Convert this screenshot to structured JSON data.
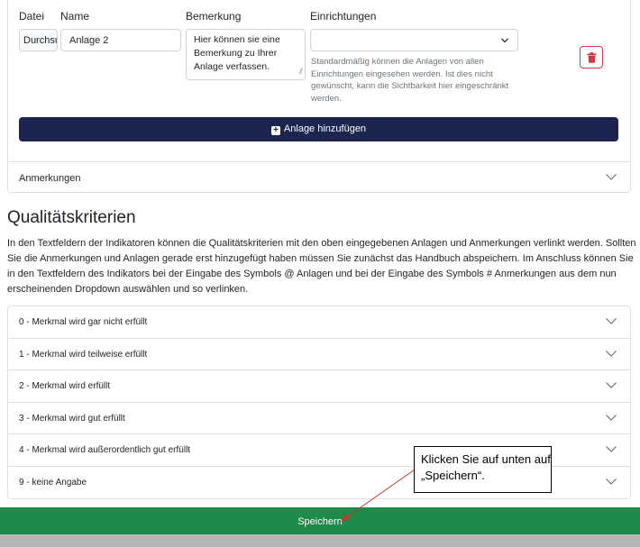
{
  "anlagen": {
    "col_datei": "Datei",
    "col_name": "Name",
    "col_bemerkung": "Bemerkung",
    "col_einrichtungen": "Einrichtungen",
    "file_button_label": "Durchsuchen...",
    "name_value": "Anlage 2",
    "bemerkung_value": "Hier können sie eine Bemerkung zu Ihrer Anlage verfassen.",
    "einrichtungen_selected": "",
    "help_text": "Standardmäßig können die Anlagen von allen Einrichtungen eingesehen werden. Ist dies nicht gewünscht, kann die Sichtbarkeit hier eingeschränkt werden.",
    "add_button_label": "Anlage hinzufügen",
    "danger_color": "#dc3545",
    "add_button_color": "#1b2550"
  },
  "anmerkungen": {
    "label": "Anmerkungen"
  },
  "qualitaet": {
    "title": "Qualitätskriterien",
    "description": "In den Textfeldern der Indikatoren können die Qualitätskriterien mit den oben eingegebenen Anlagen und Anmerkungen verlinkt werden. Sollten Sie die Anmerkungen und Anlagen gerade erst hinzugefügt haben müssen Sie zunächst das Handbuch abspeichern. Im Anschluss können Sie in den Textfeldern des Indikators bei der Eingabe des Symbols @ Anlagen und bei der Eingabe des Symbols # Anmerkungen aus dem nun erscheinenden Dropdown auswählen und so verlinken.",
    "items": [
      {
        "label": "0 - Merkmal wird gar nicht erfüllt"
      },
      {
        "label": "1 - Merkmal wird teilweise erfüllt"
      },
      {
        "label": "2 - Merkmal wird erfüllt"
      },
      {
        "label": "3 - Merkmal wird gut erfüllt"
      },
      {
        "label": "4 - Merkmal wird außerordentlich gut erfüllt"
      },
      {
        "label": "9 - keine Angabe"
      }
    ]
  },
  "callout": {
    "text": "Klicken Sie auf unten auf „Speichern“."
  },
  "save": {
    "label": "Speichern",
    "color": "#1e8a4b"
  }
}
